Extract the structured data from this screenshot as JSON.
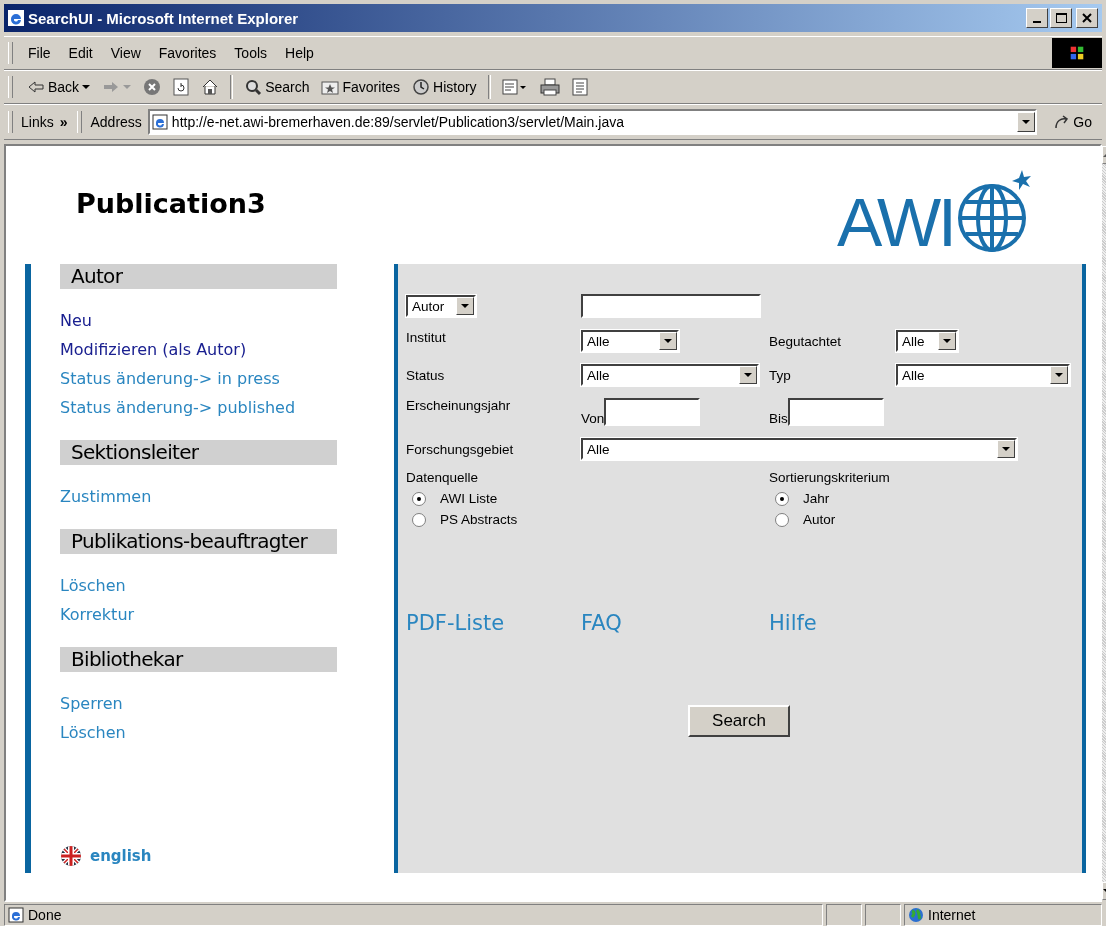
{
  "window": {
    "title": "SearchUI - Microsoft Internet Explorer"
  },
  "menu": [
    "File",
    "Edit",
    "View",
    "Favorites",
    "Tools",
    "Help"
  ],
  "toolbar": [
    {
      "kind": "back",
      "label": "Back"
    },
    {
      "kind": "forward"
    },
    {
      "kind": "stop"
    },
    {
      "kind": "refresh"
    },
    {
      "kind": "home"
    },
    {
      "kind": "sep"
    },
    {
      "kind": "search",
      "label": "Search"
    },
    {
      "kind": "favorites",
      "label": "Favorites"
    },
    {
      "kind": "history",
      "label": "History"
    },
    {
      "kind": "sep"
    },
    {
      "kind": "mail"
    },
    {
      "kind": "print"
    },
    {
      "kind": "edit"
    }
  ],
  "address_bar": {
    "links_label": "Links",
    "chevron": "»",
    "label": "Address",
    "url": "http://e-net.awi-bremerhaven.de:89/servlet/Publication3/servlet/Main.java",
    "go": "Go"
  },
  "page": {
    "title": "Publication3",
    "logo": "AWI",
    "sidebar": [
      {
        "heading": "Autor",
        "links": [
          {
            "label": "Neu",
            "visited": true
          },
          {
            "label": "Modifizieren (als Autor)",
            "visited": true
          },
          {
            "label": "Status änderung-> in press",
            "visited": false
          },
          {
            "label": "Status änderung-> published",
            "visited": false
          }
        ]
      },
      {
        "heading": "Sektionsleiter",
        "links": [
          {
            "label": "Zustimmen",
            "visited": false
          }
        ]
      },
      {
        "heading": "Publikations-beauftragter",
        "links": [
          {
            "label": "Löschen",
            "visited": false
          },
          {
            "label": "Korrektur",
            "visited": false
          }
        ]
      },
      {
        "heading": "Bibliothekar",
        "links": [
          {
            "label": "Sperren",
            "visited": false
          },
          {
            "label": "Löschen",
            "visited": false
          }
        ]
      }
    ],
    "language": "english",
    "form": {
      "search_by": "Autor",
      "institut": {
        "label": "Institut",
        "value": "Alle"
      },
      "begutachtet": {
        "label": "Begutachtet",
        "value": "Alle"
      },
      "status": {
        "label": "Status",
        "value": "Alle"
      },
      "typ": {
        "label": "Typ",
        "value": "Alle"
      },
      "year": {
        "label": "Erscheinungsjahr",
        "from": "Von",
        "to": "Bis"
      },
      "forschungsgebiet": {
        "label": "Forschungsgebiet",
        "value": "Alle"
      },
      "datenquelle": {
        "label": "Datenquelle",
        "options": [
          {
            "label": "AWI Liste",
            "selected": true
          },
          {
            "label": "PS Abstracts",
            "selected": false
          }
        ]
      },
      "sortierung": {
        "label": "Sortierungskriterium",
        "options": [
          {
            "label": "Jahr",
            "selected": true
          },
          {
            "label": "Autor",
            "selected": false
          }
        ]
      },
      "links": [
        "PDF-Liste",
        "FAQ",
        "Hilfe"
      ],
      "button": "Search"
    }
  },
  "status_bar": {
    "text": "Done",
    "zone": "Internet"
  }
}
